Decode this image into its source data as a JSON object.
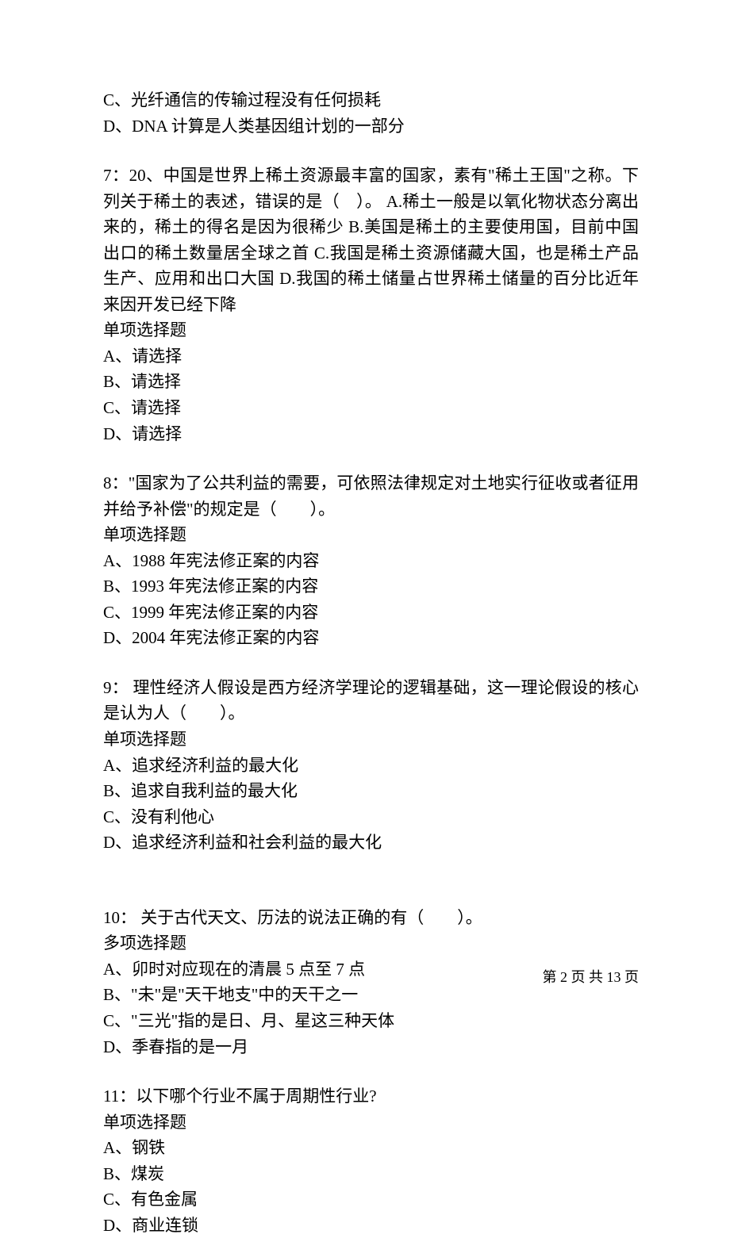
{
  "partial_q6": {
    "options": [
      "C、光纤通信的传输过程没有任何损耗",
      "D、DNA 计算是人类基因组计划的一部分"
    ]
  },
  "q7": {
    "text": "7：20、中国是世界上稀土资源最丰富的国家，素有\"稀土王国\"之称。下列关于稀土的表述，错误的是（　）。 A.稀土一般是以氧化物状态分离出来的，稀土的得名是因为很稀少 B.美国是稀土的主要使用国，目前中国出口的稀土数量居全球之首 C.我国是稀土资源储藏大国，也是稀土产品生产、应用和出口大国 D.我国的稀土储量占世界稀土储量的百分比近年来因开发已经下降",
    "type": "单项选择题",
    "options": [
      "A、请选择",
      "B、请选择",
      "C、请选择",
      "D、请选择"
    ]
  },
  "q8": {
    "text": "8：\"国家为了公共利益的需要，可依照法律规定对土地实行征收或者征用并给予补偿\"的规定是（　　）。",
    "type": "单项选择题",
    "options": [
      "A、1988 年宪法修正案的内容",
      "B、1993 年宪法修正案的内容",
      "C、1999 年宪法修正案的内容",
      "D、2004 年宪法修正案的内容"
    ]
  },
  "q9": {
    "text": "9：  理性经济人假设是西方经济学理论的逻辑基础，这一理论假设的核心是认为人（　　）。",
    "type": "单项选择题",
    "options": [
      "A、追求经济利益的最大化",
      "B、追求自我利益的最大化",
      "C、没有利他心",
      "D、追求经济利益和社会利益的最大化"
    ]
  },
  "q10": {
    "text": "10：  关于古代天文、历法的说法正确的有（　　）。",
    "type": "多项选择题",
    "options": [
      "A、卯时对应现在的清晨 5 点至 7 点",
      "B、\"未\"是\"天干地支\"中的天干之一",
      "C、\"三光\"指的是日、月、星这三种天体",
      "D、季春指的是一月"
    ]
  },
  "q11": {
    "text": "11：以下哪个行业不属于周期性行业?",
    "type": "单项选择题",
    "options": [
      "A、钢铁",
      "B、煤炭",
      "C、有色金属",
      "D、商业连锁"
    ]
  },
  "footer": "第 2 页 共 13 页"
}
